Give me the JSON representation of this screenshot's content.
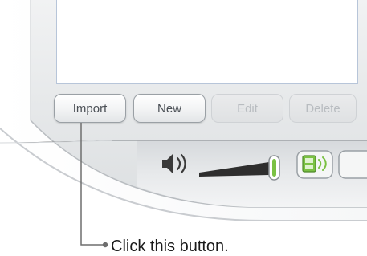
{
  "buttons": {
    "import_label": "Import",
    "new_label": "New",
    "edit_label": "Edit",
    "delete_label": "Delete"
  },
  "callout": {
    "text": "Click this button."
  },
  "colors": {
    "device_body": "#e8e9ea",
    "device_bezel": "#ffffff",
    "list_border": "#b7c5d9",
    "volume_accent": "#7ac143",
    "disabled_text": "#b8bcc0",
    "enabled_text": "#4a4f55"
  },
  "icons": {
    "speaker": "speaker-icon",
    "volume_knob": "volume-knob-icon",
    "display_toggle": "display-toggle-icon"
  }
}
